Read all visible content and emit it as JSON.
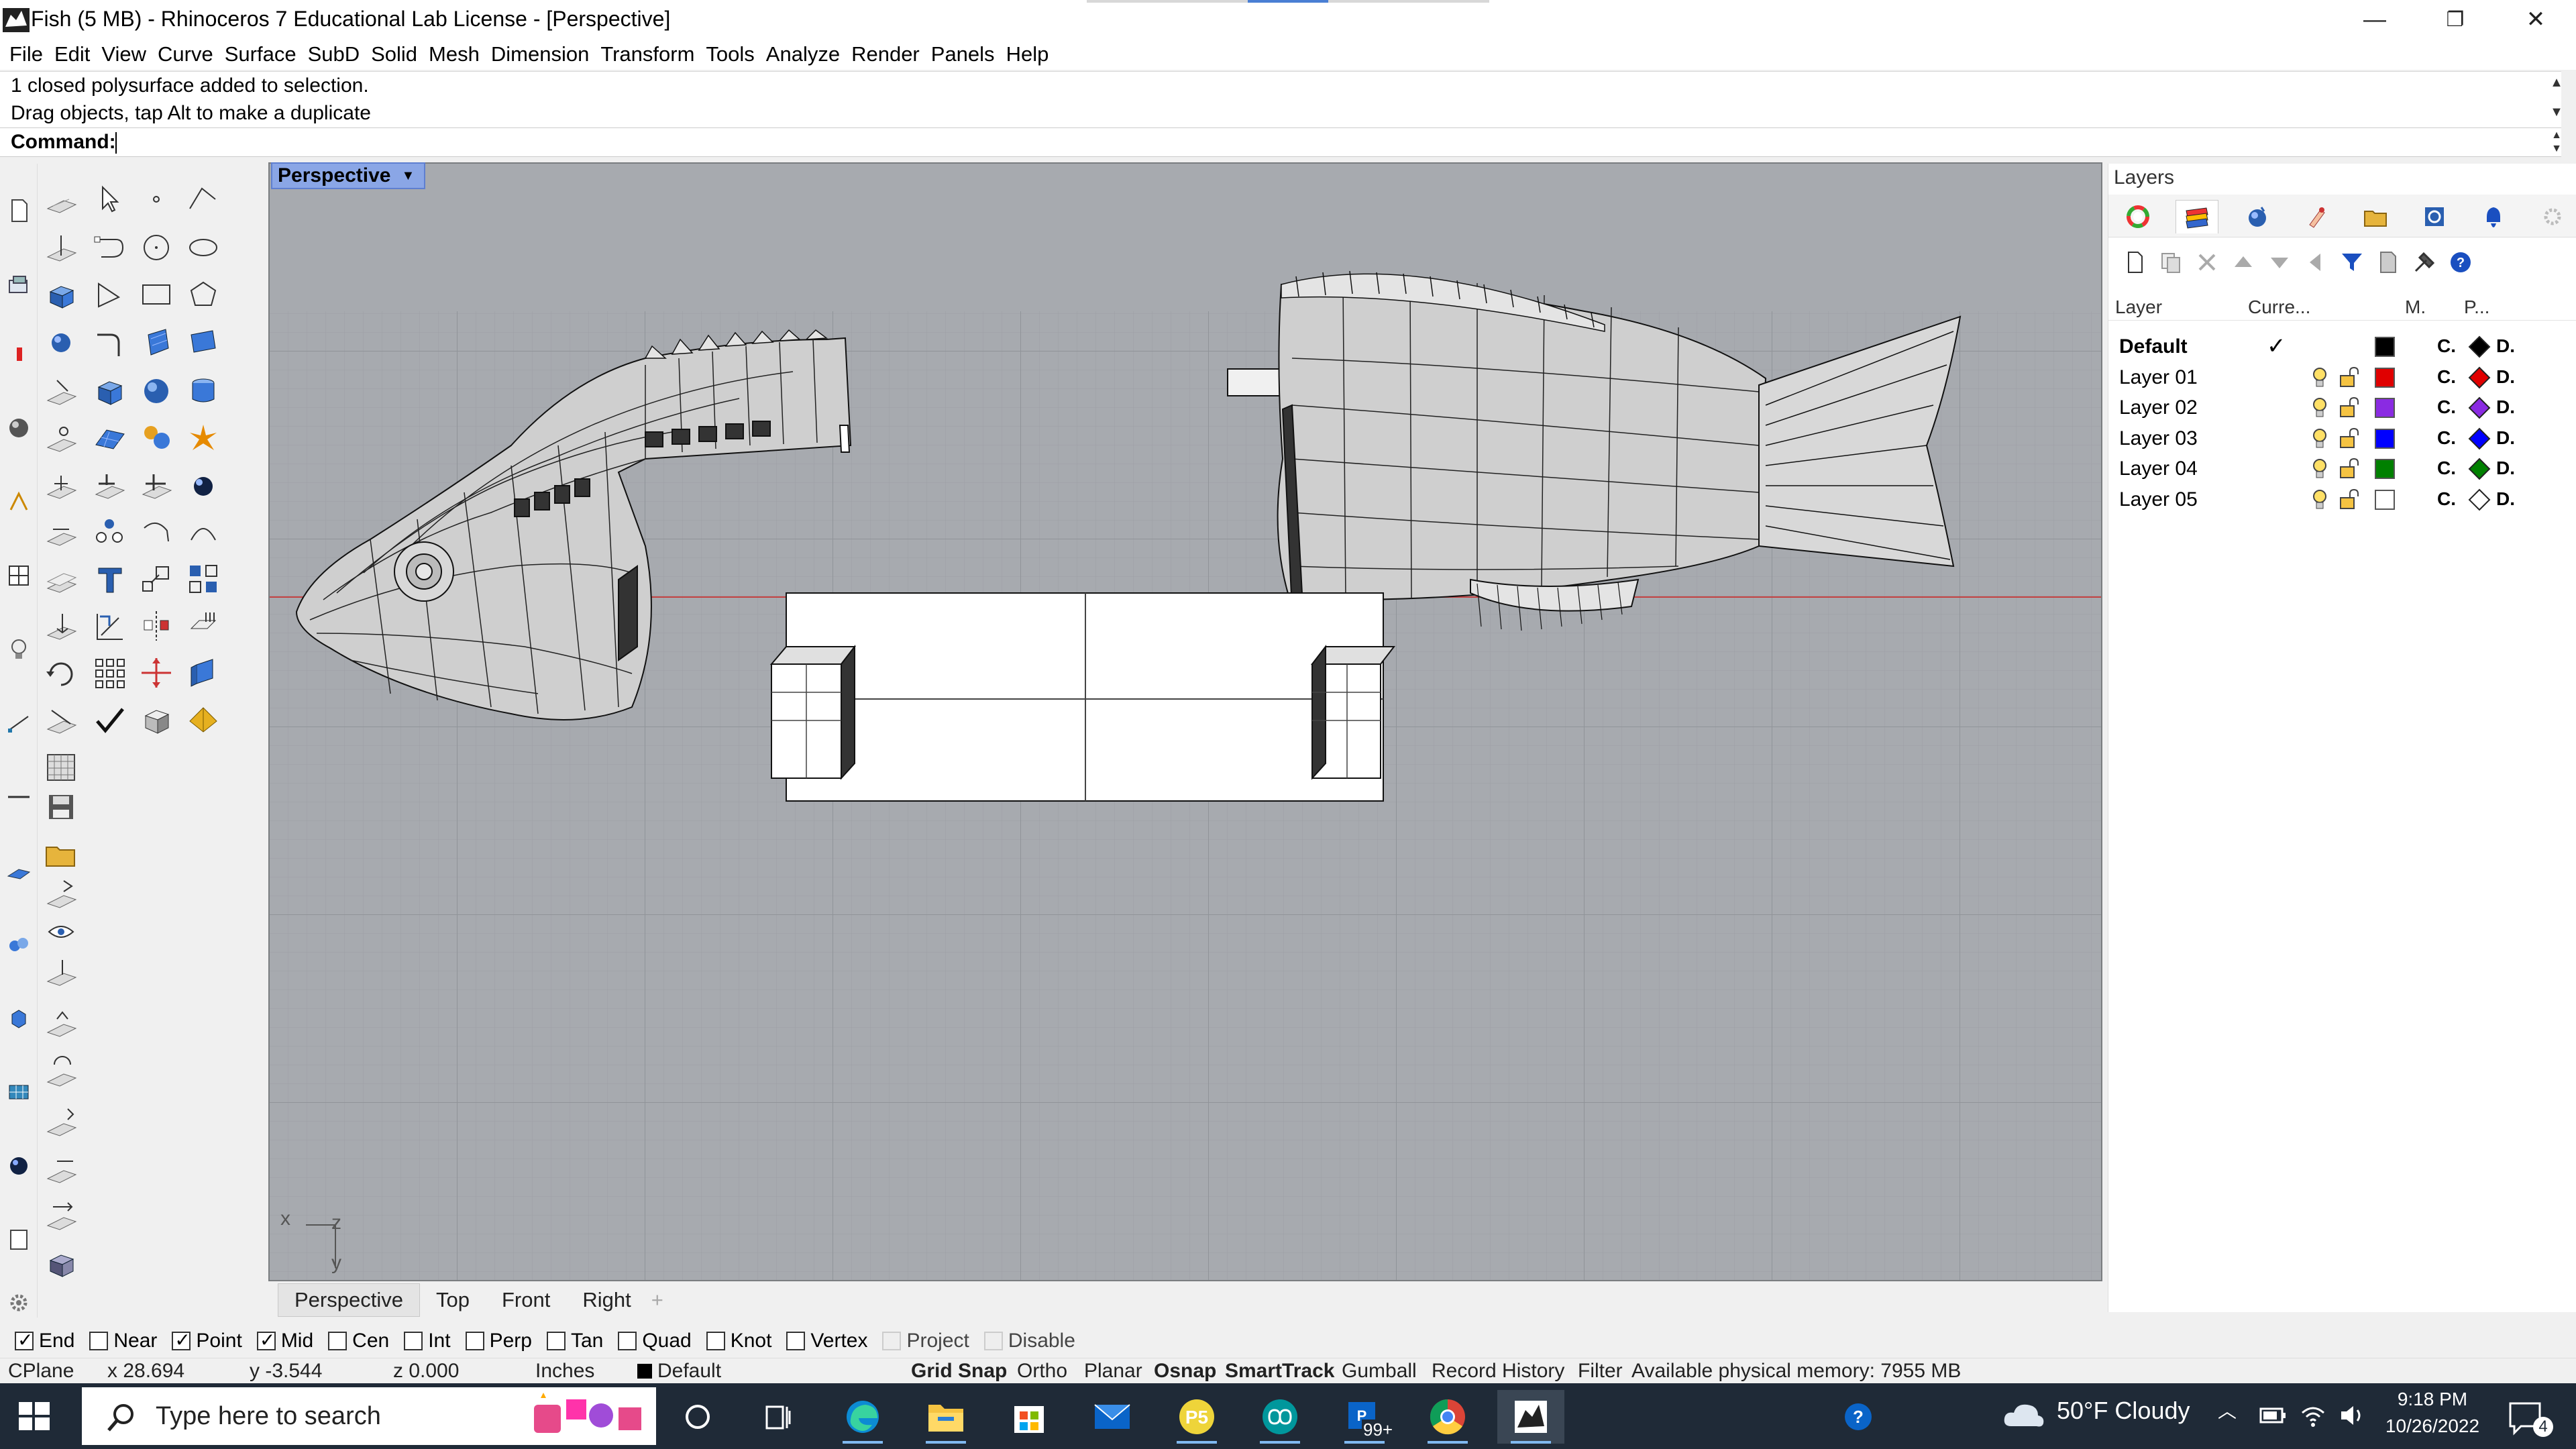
{
  "window": {
    "title": "Fish (5 MB) - Rhinoceros 7 Educational Lab License - [Perspective]",
    "minimize": "—",
    "restore": "❐",
    "close": "✕"
  },
  "menu": [
    "File",
    "Edit",
    "View",
    "Curve",
    "Surface",
    "SubD",
    "Solid",
    "Mesh",
    "Dimension",
    "Transform",
    "Tools",
    "Analyze",
    "Render",
    "Panels",
    "Help"
  ],
  "command": {
    "history": [
      "1 closed polysurface added to selection.",
      "Drag objects, tap Alt to make a duplicate"
    ],
    "prompt_label": "Command:",
    "value": ""
  },
  "viewport": {
    "active_name": "Perspective",
    "axis_x": "x",
    "axis_y": "y",
    "axis_z": "z"
  },
  "view_tabs": [
    "Perspective",
    "Top",
    "Front",
    "Right"
  ],
  "view_tab_add": "+",
  "layers_panel": {
    "title": "Layers",
    "columns": {
      "layer": "Layer",
      "current": "Curre...",
      "material": "M.",
      "print": "P..."
    },
    "layers": [
      {
        "name": "Default",
        "current": "✓",
        "color": "#000000",
        "material": "C.",
        "print_color": "#000000",
        "print": "D."
      },
      {
        "name": "Layer 01",
        "current": "",
        "color": "#e00000",
        "material": "C.",
        "print_color": "#e00000",
        "print": "D."
      },
      {
        "name": "Layer 02",
        "current": "",
        "color": "#8a2be2",
        "material": "C.",
        "print_color": "#8a2be2",
        "print": "D."
      },
      {
        "name": "Layer 03",
        "current": "",
        "color": "#0000ff",
        "material": "C.",
        "print_color": "#0000ff",
        "print": "D."
      },
      {
        "name": "Layer 04",
        "current": "",
        "color": "#008000",
        "material": "C.",
        "print_color": "#008000",
        "print": "D."
      },
      {
        "name": "Layer 05",
        "current": "",
        "color": "#ffffff",
        "material": "C.",
        "print_color": "#ffffff",
        "print": "D."
      }
    ]
  },
  "osnap": [
    {
      "label": "End",
      "checked": true
    },
    {
      "label": "Near",
      "checked": false
    },
    {
      "label": "Point",
      "checked": true
    },
    {
      "label": "Mid",
      "checked": true
    },
    {
      "label": "Cen",
      "checked": false
    },
    {
      "label": "Int",
      "checked": false
    },
    {
      "label": "Perp",
      "checked": false
    },
    {
      "label": "Tan",
      "checked": false
    },
    {
      "label": "Quad",
      "checked": false
    },
    {
      "label": "Knot",
      "checked": false
    },
    {
      "label": "Vertex",
      "checked": false
    },
    {
      "label": "Project",
      "checked": false,
      "disabled": true
    },
    {
      "label": "Disable",
      "checked": false,
      "disabled": true
    }
  ],
  "status": {
    "cplane": "CPlane",
    "x": "x 28.694",
    "y": "y -3.544",
    "z": "z 0.000",
    "units": "Inches",
    "layer": "Default",
    "grid_snap": "Grid Snap",
    "ortho": "Ortho",
    "planar": "Planar",
    "osnap": "Osnap",
    "smarttrack": "SmartTrack",
    "gumball": "Gumball",
    "record_history": "Record History",
    "filter": "Filter",
    "memory": "Available physical memory: 7955 MB"
  },
  "taskbar": {
    "search_placeholder": "Type here to search",
    "mail_badge": "99+",
    "weather": "50°F  Cloudy",
    "time": "9:18 PM",
    "date": "10/26/2022",
    "notifications": "4"
  },
  "colors": {
    "viewport_bg": "#a7aaaf",
    "active_tab": "#8aa6e6",
    "taskbar": "#1f2a37"
  }
}
